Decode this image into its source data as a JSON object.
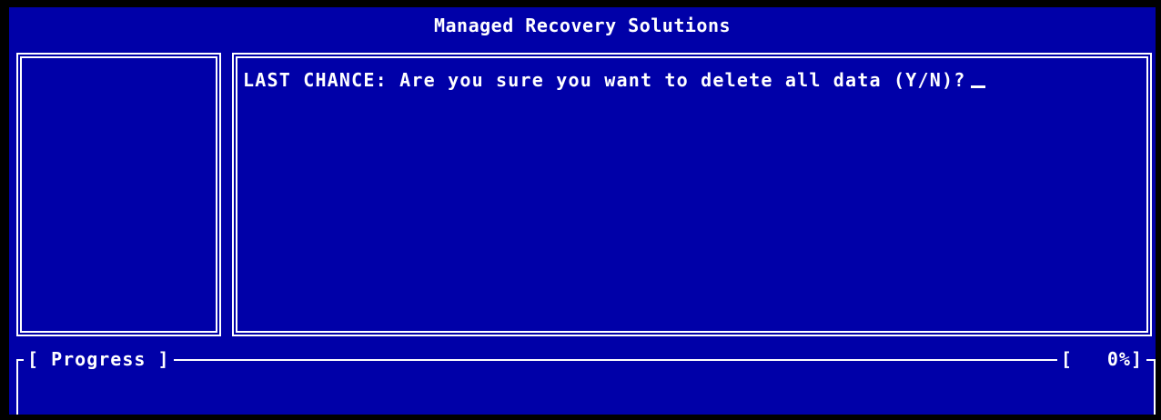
{
  "window": {
    "title": "Managed Recovery Solutions"
  },
  "main": {
    "prompt": "LAST CHANCE: Are you sure you want to delete all data (Y/N)?",
    "input_value": ""
  },
  "progress": {
    "label": "[ Progress ]",
    "open_bracket": "[",
    "percent_text": "0%]",
    "percent_value": 0
  },
  "colors": {
    "background": "#0000a8",
    "foreground": "#ffffff"
  }
}
